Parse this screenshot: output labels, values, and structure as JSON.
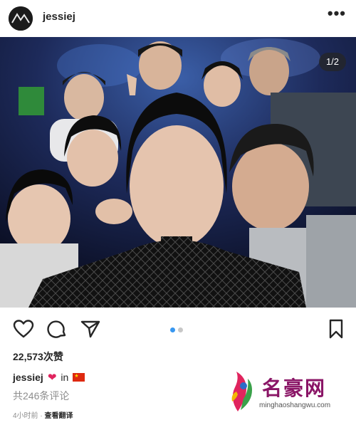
{
  "header": {
    "username": "jessiej",
    "more_label": "•••"
  },
  "photo": {
    "counter": "1/2"
  },
  "actions": {
    "icons": [
      "heart-icon",
      "comment-icon",
      "share-icon",
      "bookmark-icon"
    ],
    "carousel_total": 2,
    "carousel_active": 1
  },
  "post": {
    "likes": "22,573次赞",
    "caption_user": "jessiej",
    "caption_in": "in",
    "comments": "共246条评论",
    "time": "4小时前",
    "see_translation": "查看翻译"
  },
  "watermark": {
    "name": "名豪网",
    "url": "minghaoshangwu.com"
  },
  "colors": {
    "accent_blue": "#3897f0",
    "heart_red": "#e0245e",
    "watermark_purple": "#8a1566"
  }
}
